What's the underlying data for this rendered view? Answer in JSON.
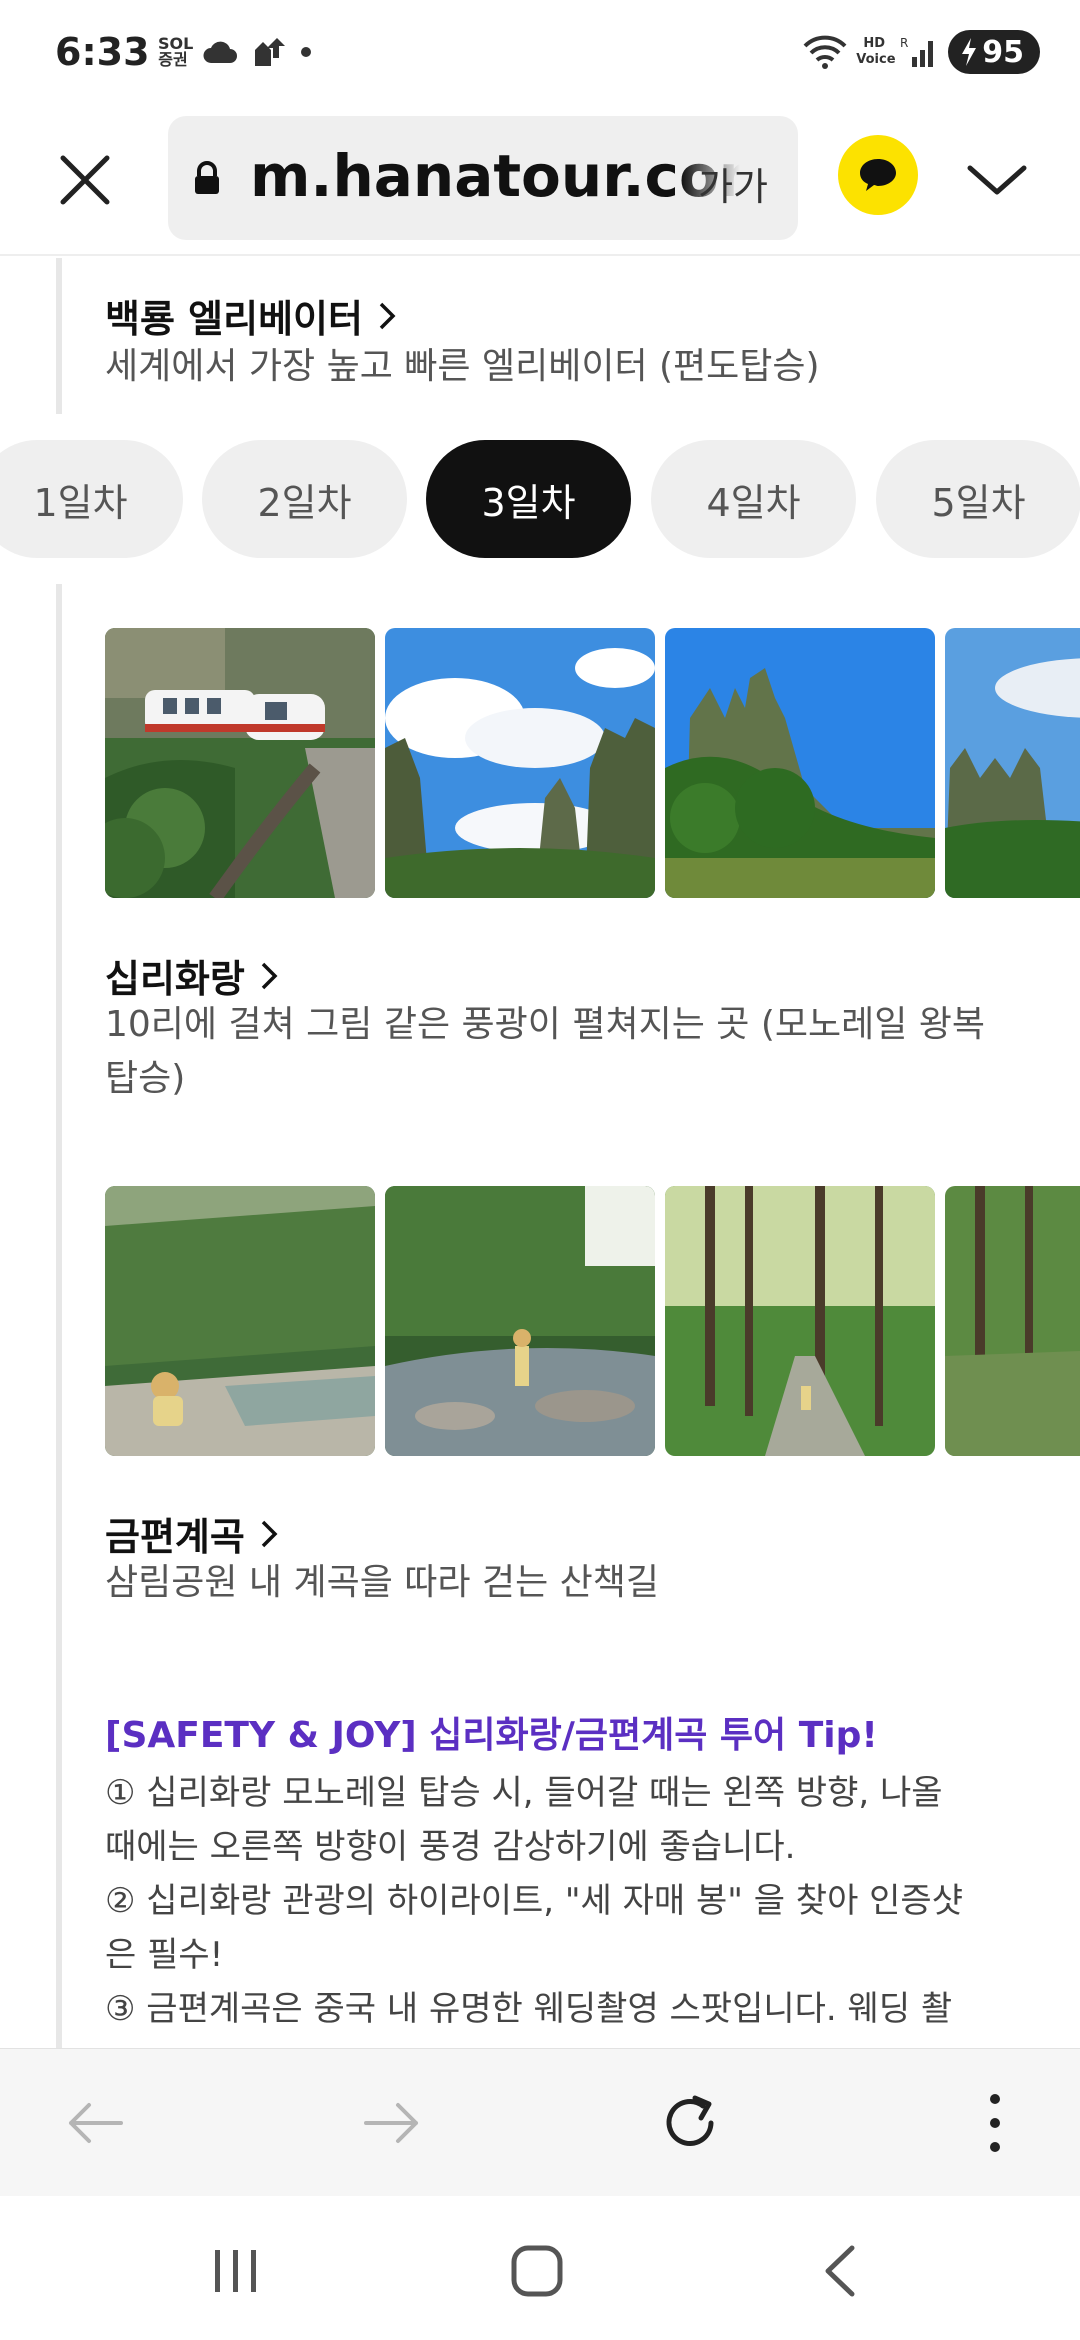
{
  "status_bar": {
    "time": "6:33",
    "left_icon_text": "SOL\n증권",
    "right_icon_text": "HD\nVoice",
    "battery": "95"
  },
  "browser": {
    "url": "m.hanatour.com",
    "text_size_label": "가가"
  },
  "content": {
    "attraction1": {
      "title": "백룡 엘리베이터",
      "desc": "세계에서 가장 높고 빠른 엘리베이터 (편도탑승)"
    },
    "day_tabs": [
      "1일차",
      "2일차",
      "3일차",
      "4일차",
      "5일차"
    ],
    "active_day": "3일차",
    "attraction2": {
      "title": "십리화랑",
      "desc": "10리에 걸쳐 그림 같은 풍광이 펼쳐지는 곳 (모노레일 왕복 탑승)"
    },
    "attraction3": {
      "title": "금편계곡",
      "desc": "삼림공원 내 계곡을 따라 걷는 산책길"
    },
    "tip": {
      "title": "[SAFETY & JOY] 십리화랑/금편계곡 투어 Tip!",
      "lines": [
        "① 십리화랑 모노레일 탑승 시, 들어갈 때는 왼쪽 방향, 나올",
        "때에는 오른쪽 방향이 풍경 감상하기에 좋습니다.",
        "② 십리화랑 관광의 하이라이트, \"세 자매 봉\" 을 찾아 인증샷",
        "은 필수!",
        "③ 금편계곡은 중국 내 유명한 웨딩촬영 스팟입니다. 웨딩 촬"
      ]
    }
  },
  "colors": {
    "tip_accent": "#5b2fc2",
    "active_tab": "#111111",
    "talk_button": "#fce200"
  },
  "icons": {
    "close": "close-icon",
    "lock": "lock-icon",
    "talk": "chat-bubble-icon",
    "chevron": "chevron-down-icon",
    "back": "arrow-left-icon",
    "forward": "arrow-right-icon",
    "reload": "reload-icon",
    "menu": "more-vertical-icon"
  }
}
